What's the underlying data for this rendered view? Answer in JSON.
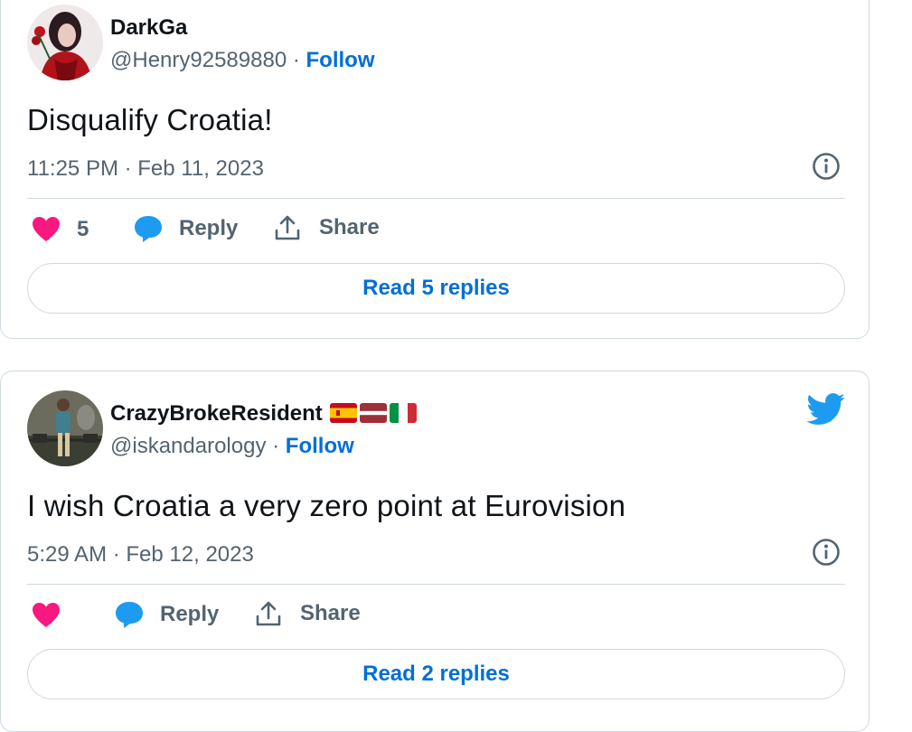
{
  "tweets": [
    {
      "display_name": "DarkGa",
      "handle": "@Henry92589880",
      "separator": "·",
      "follow_label": "Follow",
      "text": "Disqualify Croatia!",
      "timestamp": "11:25 PM · Feb 11, 2023",
      "like_count": "5",
      "reply_label": "Reply",
      "share_label": "Share",
      "read_replies_label": "Read 5 replies",
      "avatar_icon": "avatar-drag-queen-red",
      "verified_flags": []
    },
    {
      "display_name": "CrazyBrokeResident",
      "handle": "@iskandarology",
      "separator": "·",
      "follow_label": "Follow",
      "text": "I wish Croatia a very zero point at Eurovision",
      "timestamp": "5:29 AM · Feb 12, 2023",
      "like_count": "",
      "reply_label": "Reply",
      "share_label": "Share",
      "read_replies_label": "Read 2 replies",
      "avatar_icon": "avatar-man-standing",
      "verified_flags": [
        "flag-spain-icon",
        "flag-latvia-icon",
        "flag-italy-icon"
      ]
    }
  ],
  "colors": {
    "like": "#f91880",
    "reply": "#1d9bf0",
    "link": "#006fd6",
    "twitter_blue": "#1d9bf0",
    "muted": "#536471",
    "border": "#cfd9de"
  }
}
